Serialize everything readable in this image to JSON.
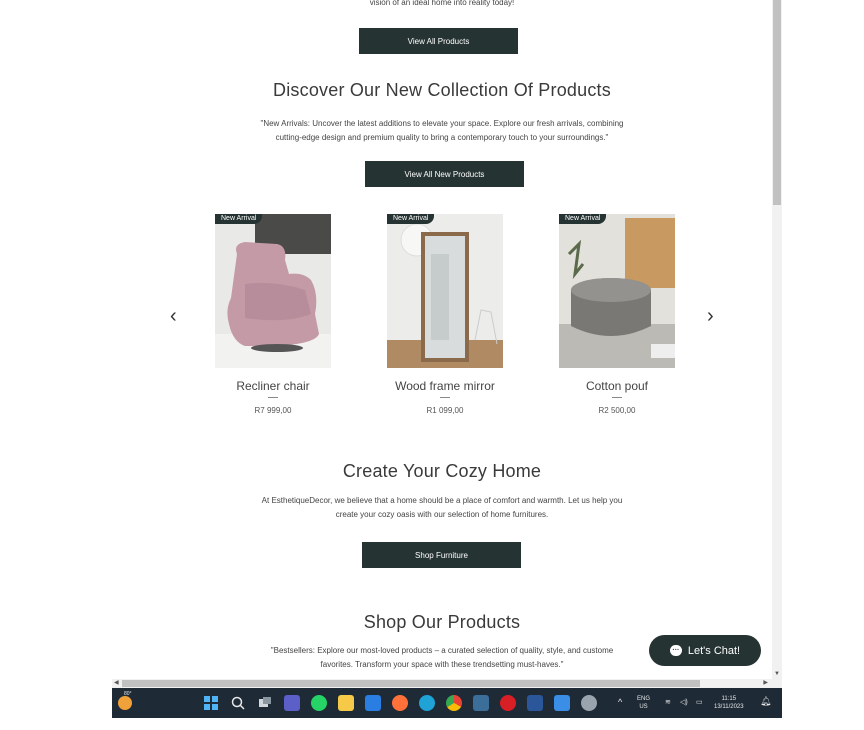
{
  "intro_tail": "vision of an ideal home into reality today!",
  "view_all_button": "View All Products",
  "new_collection": {
    "title": "Discover Our New Collection Of Products",
    "desc_line1": "\"New Arrivals: Uncover the latest additions to elevate your space. Explore our fresh arrivals, combining",
    "desc_line2": "cutting-edge design and premium quality to bring a contemporary touch to your surroundings.\"",
    "button": "View All New Products"
  },
  "products": [
    {
      "badge": "New Arrival",
      "name": "Recliner chair",
      "price": "R7 999,00"
    },
    {
      "badge": "New Arrival",
      "name": "Wood frame mirror",
      "price": "R1 099,00"
    },
    {
      "badge": "New Arrival",
      "name": "Cotton pouf",
      "price": "R2 500,00"
    }
  ],
  "carousel": {
    "prev": "‹",
    "next": "›"
  },
  "cozy": {
    "title": "Create Your Cozy Home",
    "desc_line1": "At EsthetiqueDecor, we believe that a home should be a place of comfort and warmth. Let us help you",
    "desc_line2": "create your cozy oasis with our selection of home furnitures.",
    "button": "Shop Furniture"
  },
  "shop": {
    "title": "Shop Our Products",
    "desc_line1": "\"Bestsellers: Explore our most-loved products – a curated selection of quality, style, and custome",
    "desc_line2": "favorites. Transform your space with these trendsetting must-haves.\""
  },
  "chat_button": "Let's Chat!",
  "taskbar": {
    "weather": "80°",
    "lang_line1": "ENG",
    "lang_line2": "US",
    "time": "11:15",
    "date": "13/11/2023",
    "icons": [
      "windows-start-icon",
      "search-icon",
      "task-view-icon",
      "teams-icon",
      "whatsapp-icon",
      "file-explorer-icon",
      "mail-icon",
      "firefox-icon",
      "edge-icon",
      "chrome-icon",
      "files-icon",
      "opera-icon",
      "word-icon",
      "paint-icon",
      "settings-icon"
    ],
    "colors": {
      "bar": "#1f2a37",
      "accent": "#253332"
    }
  }
}
